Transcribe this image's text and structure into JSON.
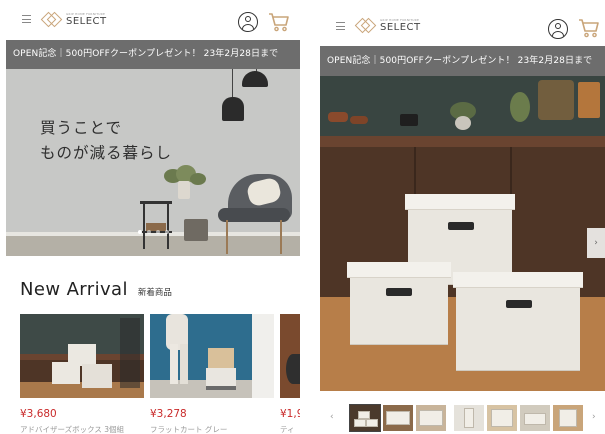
{
  "brand": {
    "sub": "GRIP HOME FURNITURE",
    "name": "SELECT",
    "color": "#c9a57a"
  },
  "promo": {
    "text": "OPEN記念｜500円OFFクーポンプレゼント！ 23年2月28日まで",
    "bg": "#6d6d6d"
  },
  "hero": {
    "copy": "買うことで\nものが減る暮らし",
    "slide_dots": 4,
    "active_slide": 1
  },
  "new_arrival": {
    "title": "New Arrival",
    "subtitle": "新着商品",
    "products": [
      {
        "price": "¥3,680",
        "name": "アドバイザーズボックス 3個組"
      },
      {
        "price": "¥3,278",
        "name": "フラットカート グレー"
      },
      {
        "price": "¥1,9",
        "name": "ティ"
      }
    ],
    "price_color": "#c92a2a"
  },
  "gallery": {
    "next_label": "›",
    "prev_label": "‹",
    "thumb_count": 7
  },
  "icons": {
    "menu": "hamburger-icon",
    "account": "account-icon",
    "cart": "cart-icon"
  }
}
